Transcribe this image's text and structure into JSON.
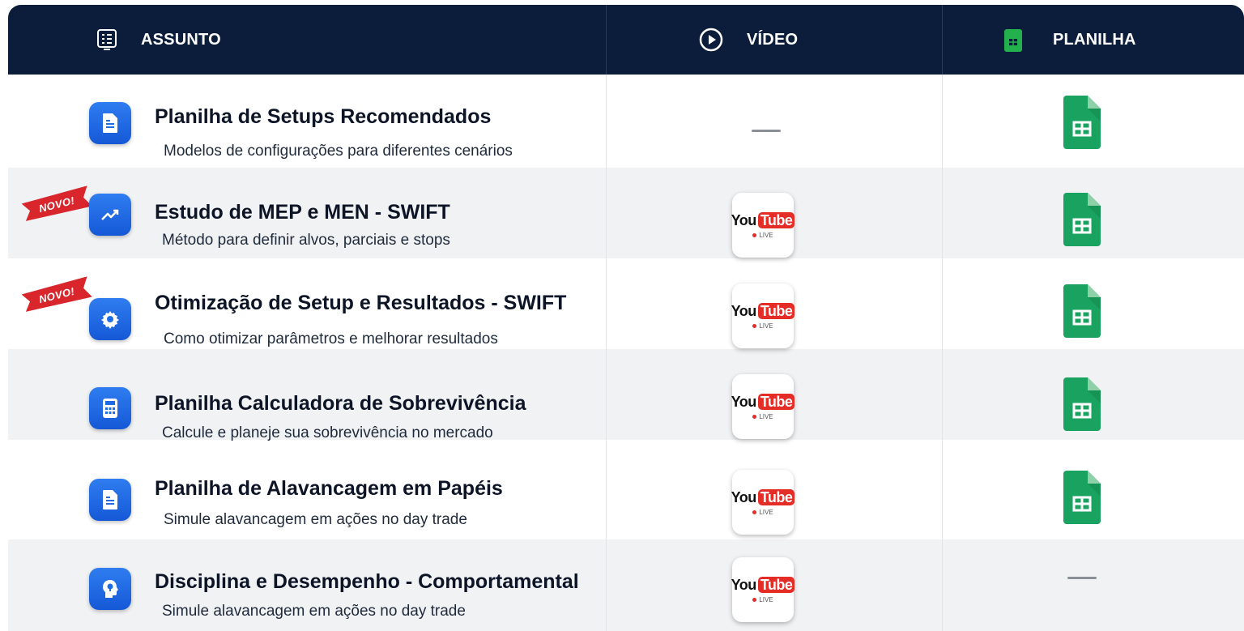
{
  "header": {
    "subject_label": "ASSUNTO",
    "video_label": "VÍDEO",
    "sheet_label": "PLANILHA",
    "subject_icon": "list-icon",
    "video_icon": "play-circle-icon",
    "sheet_icon": "google-sheets-icon"
  },
  "rows": [
    {
      "title": "Planilha de Setups Recomendados",
      "subtitle": "Modelos de configurações para diferentes cenários",
      "icon": "document-icon",
      "badge": "",
      "video": "none",
      "sheet": "available"
    },
    {
      "title": "Estudo de MEP e MEN - SWIFT",
      "subtitle": "Método para definir alvos, parciais e stops",
      "icon": "trending-up-icon",
      "badge": "NOVO!",
      "video": "youtube-live",
      "sheet": "available"
    },
    {
      "title": "Otimização de Setup e Resultados - SWIFT",
      "subtitle": "Como otimizar parâmetros e melhorar resultados",
      "icon": "gear-icon",
      "badge": "NOVO!",
      "video": "youtube-live",
      "sheet": "available"
    },
    {
      "title": "Planilha Calculadora de Sobrevivência",
      "subtitle": "Calcule e planeje sua sobrevivência no mercado",
      "icon": "calculator-icon",
      "badge": "",
      "video": "youtube-live",
      "sheet": "available"
    },
    {
      "title": "Planilha de Alavancagem em Papéis",
      "subtitle": "Simule alavancagem em ações no day trade",
      "icon": "document-icon",
      "badge": "",
      "video": "youtube-live",
      "sheet": "available"
    },
    {
      "title": "Disciplina e Desempenho - Comportamental",
      "subtitle": "Simule alavancagem em ações no day trade",
      "icon": "head-brain-icon",
      "badge": "",
      "video": "youtube-live",
      "sheet": "none"
    }
  ],
  "youtube": {
    "you": "You",
    "tube": "Tube",
    "live": "LIVE"
  },
  "colors": {
    "header_bg": "#0b1d3a",
    "icon_blue": "#1f6be3",
    "sheets_green": "#1aa260",
    "youtube_red": "#e52d27",
    "badge_red": "#d8262c"
  }
}
